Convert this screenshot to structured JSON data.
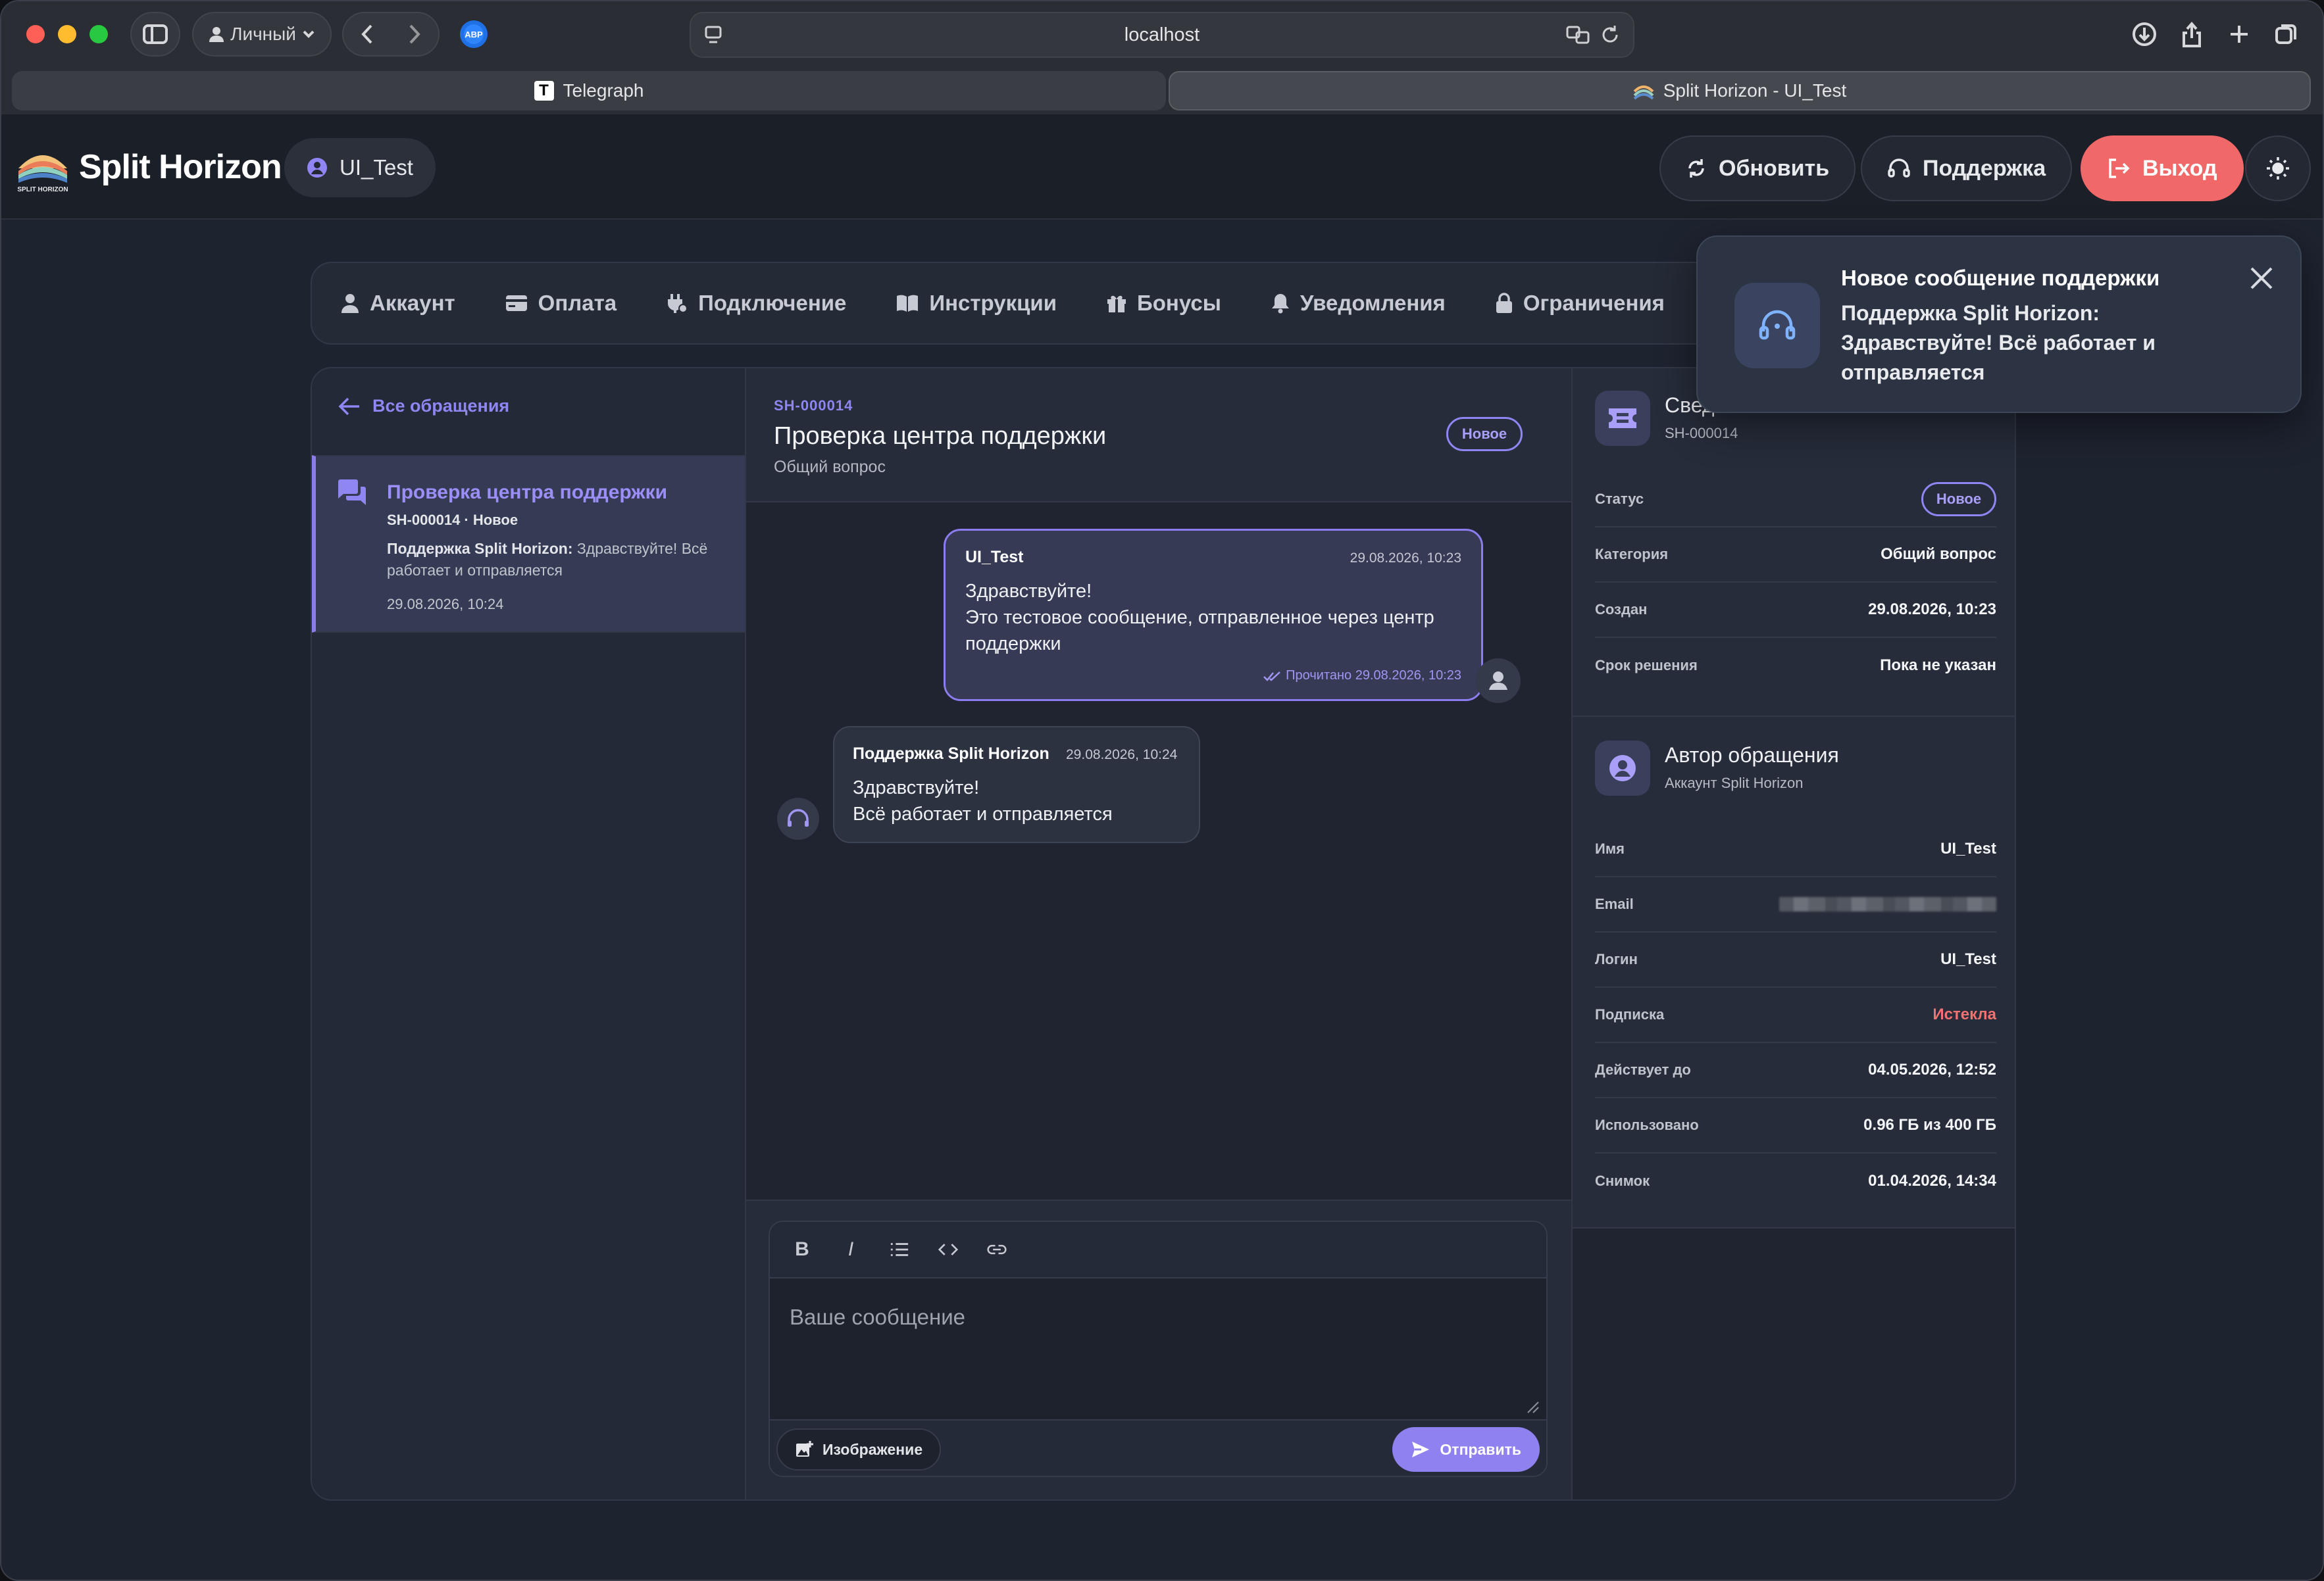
{
  "browser": {
    "profile_label": "Личный",
    "url": "localhost",
    "tabs": [
      {
        "label": "Telegraph",
        "icon": "telegraph-icon"
      },
      {
        "label": "Split Horizon - UI_Test",
        "icon": "split-horizon-favicon"
      }
    ]
  },
  "header": {
    "brand": "Split Horizon",
    "logo_text": "SPLIT HORIZON",
    "user": "UI_Test",
    "refresh_label": "Обновить",
    "support_label": "Поддержка",
    "logout_label": "Выход",
    "accent": "#f06868"
  },
  "nav": {
    "items": [
      {
        "label": "Аккаунт",
        "icon": "user-icon"
      },
      {
        "label": "Оплата",
        "icon": "card-icon"
      },
      {
        "label": "Подключение",
        "icon": "plug-icon"
      },
      {
        "label": "Инструкции",
        "icon": "book-icon"
      },
      {
        "label": "Бонусы",
        "icon": "gift-icon"
      },
      {
        "label": "Уведомления",
        "icon": "bell-icon"
      },
      {
        "label": "Ограничения",
        "icon": "lock-icon"
      }
    ]
  },
  "tickets": {
    "back_label": "Все обращения",
    "list": [
      {
        "title": "Проверка центра поддержки",
        "meta": "SH-000014 · Новое",
        "preview_author": "Поддержка Split Horizon:",
        "preview_text": "Здравствуйте! Всё работает и отправляется",
        "time": "29.08.2026, 10:24"
      }
    ]
  },
  "chat": {
    "ticket_id": "SH-000014",
    "title": "Проверка центра поддержки",
    "category": "Общий вопрос",
    "status": "Новое",
    "messages": [
      {
        "author": "UI_Test",
        "time": "29.08.2026, 10:23",
        "lines": [
          "Здравствуйте!",
          "Это тестовое сообщение, отправленное через центр поддержки"
        ],
        "read_status": "Прочитано 29.08.2026, 10:23"
      },
      {
        "author": "Поддержка Split Horizon",
        "time": "29.08.2026, 10:24",
        "lines": [
          "Здравствуйте!",
          "Всё работает и отправляется"
        ]
      }
    ],
    "composer": {
      "placeholder": "Ваше сообщение",
      "toolbar": [
        "B",
        "I",
        "list",
        "code",
        "link"
      ],
      "image_label": "Изображение",
      "send_label": "Отправить"
    }
  },
  "ticket_info": {
    "title": "Сведения о тикете",
    "subtitle": "SH-000014",
    "rows": [
      {
        "label": "Статус",
        "value": "Новое"
      },
      {
        "label": "Категория",
        "value": "Общий вопрос"
      },
      {
        "label": "Создан",
        "value": "29.08.2026, 10:23"
      },
      {
        "label": "Срок решения",
        "value": "Пока не указан"
      }
    ]
  },
  "author_info": {
    "title": "Автор обращения",
    "subtitle": "Аккаунт Split Horizon",
    "rows": [
      {
        "label": "Имя",
        "value": "UI_Test"
      },
      {
        "label": "Email",
        "value": ""
      },
      {
        "label": "Логин",
        "value": "UI_Test"
      },
      {
        "label": "Подписка",
        "value": "Истекла"
      },
      {
        "label": "Действует до",
        "value": "04.05.2026, 12:52"
      },
      {
        "label": "Использовано",
        "value": "0.96 ГБ из 400 ГБ"
      },
      {
        "label": "Снимок",
        "value": "01.04.2026, 14:34"
      }
    ]
  },
  "toast": {
    "title": "Новое сообщение поддержки",
    "body": "Поддержка Split Horizon: Здравствуйте! Всё работает и отправляется"
  },
  "colors": {
    "accent": "#8f86f3",
    "danger": "#f27171",
    "panel": "#262c3a"
  }
}
